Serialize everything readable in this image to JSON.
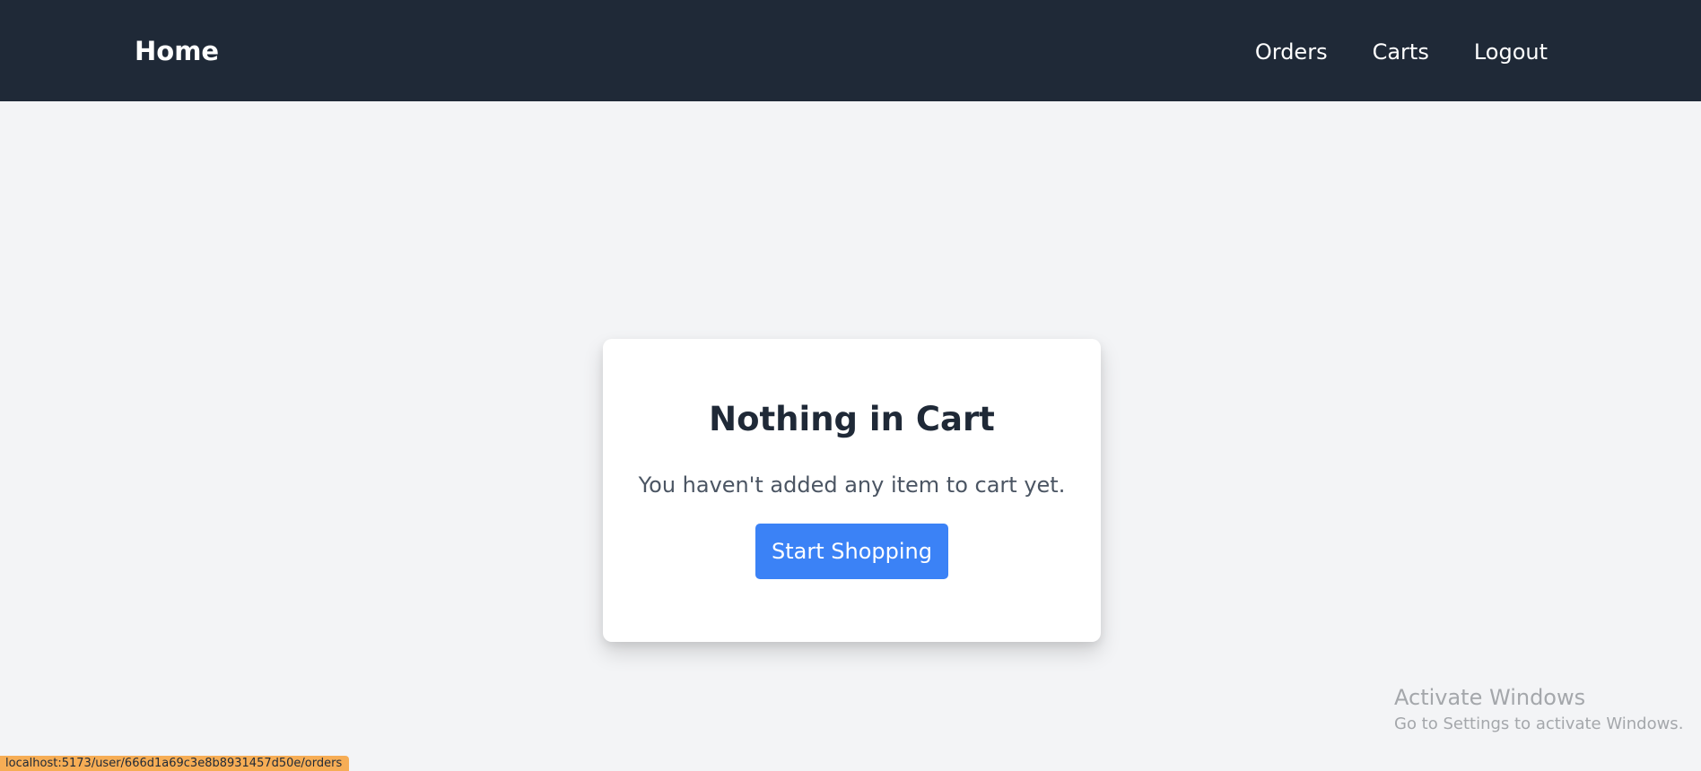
{
  "header": {
    "brand": "Home",
    "nav": [
      {
        "label": "Orders"
      },
      {
        "label": "Carts"
      },
      {
        "label": "Logout"
      }
    ]
  },
  "empty_cart": {
    "title": "Nothing in Cart",
    "message": "You haven't added any item to cart yet.",
    "button_label": "Start Shopping"
  },
  "watermark": {
    "title": "Activate Windows",
    "subtitle": "Go to Settings to activate Windows."
  },
  "status_url": "localhost:5173/user/666d1a69c3e8b8931457d50e/orders",
  "colors": {
    "navbar": "#1f2937",
    "background": "#f3f4f6",
    "primary_button": "#3b82f6",
    "status_bar": "#f6ad55"
  }
}
